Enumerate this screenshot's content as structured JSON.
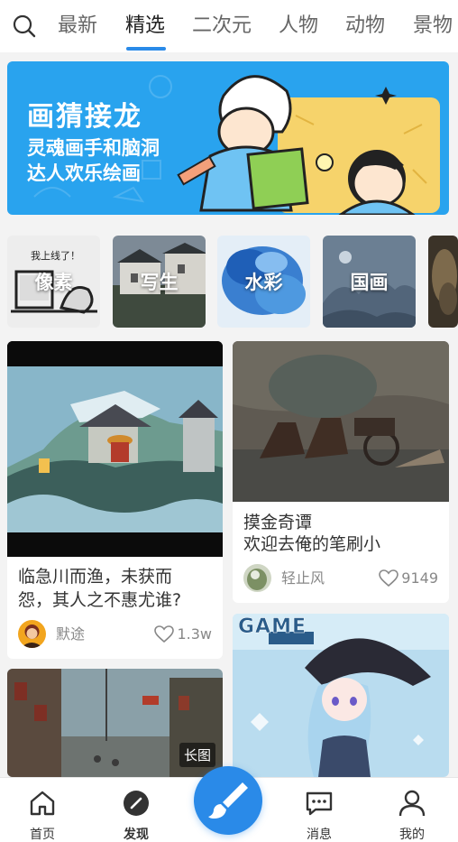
{
  "tabs": [
    {
      "label": "最新",
      "active": false
    },
    {
      "label": "精选",
      "active": true
    },
    {
      "label": "二次元",
      "active": false
    },
    {
      "label": "人物",
      "active": false
    },
    {
      "label": "动物",
      "active": false
    },
    {
      "label": "景物",
      "active": false
    }
  ],
  "banner": {
    "title": "画猜接龙",
    "subtitle_line1": "灵魂画手和脑洞",
    "subtitle_line2": "达人欢乐绘画",
    "caption": "我上线了！"
  },
  "categories": [
    {
      "label": "像素"
    },
    {
      "label": "写生"
    },
    {
      "label": "水彩"
    },
    {
      "label": "国画"
    }
  ],
  "cards": {
    "left_1": {
      "title_line1": "临急川而渔，未获而",
      "title_line2": "怨，其人之不惠尤谁?",
      "author": "默途",
      "likes": "1.3w"
    },
    "right_1": {
      "title_line1": "摸金奇谭",
      "title_line2": "欢迎去俺的笔刷小",
      "author": "轻止风",
      "likes": "9149"
    },
    "left_2": {
      "badge": "长图"
    },
    "right_2": {
      "magazine_text": "GAME"
    }
  },
  "bottom_nav": {
    "home": "首页",
    "discover": "发现",
    "messages": "消息",
    "mine": "我的"
  },
  "colors": {
    "accent": "#2a8ae8",
    "banner_bg": "#29a3ee"
  },
  "icons": [
    "search-icon",
    "home-icon",
    "discover-icon",
    "brush-icon",
    "message-icon",
    "user-icon",
    "heart-icon"
  ]
}
